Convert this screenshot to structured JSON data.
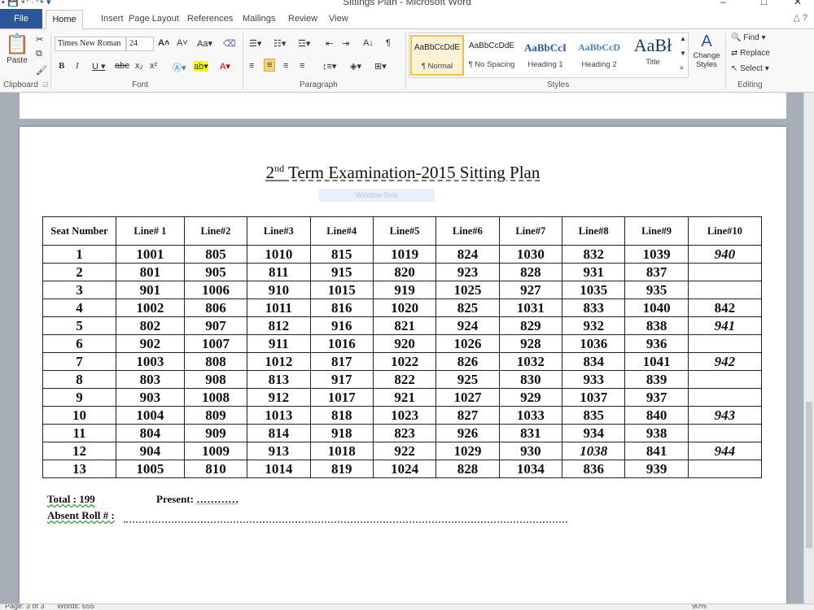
{
  "window": {
    "title": "Sittings Plan - Microsoft Word"
  },
  "ribbon": {
    "file_tab": "File",
    "tabs": [
      "Home",
      "Insert",
      "Page Layout",
      "References",
      "Mailings",
      "Review",
      "View"
    ],
    "clipboard": {
      "paste": "Paste",
      "group": "Clipboard"
    },
    "font": {
      "name": "Times New Roman",
      "size": "24",
      "group": "Font"
    },
    "paragraph": {
      "group": "Paragraph"
    },
    "styles": {
      "group": "Styles",
      "items": [
        {
          "preview": "AaBbCcDdE",
          "name": "¶ Normal"
        },
        {
          "preview": "AaBbCcDdE",
          "name": "¶ No Spacing"
        },
        {
          "preview": "AaBbCcI",
          "name": "Heading 1"
        },
        {
          "preview": "AaBbCcD",
          "name": "Heading 2"
        },
        {
          "preview": "AaBł",
          "name": "Title"
        }
      ],
      "change_styles": "Change Styles"
    },
    "editing": {
      "find": "Find",
      "replace": "Replace",
      "select": "Select",
      "group": "Editing"
    }
  },
  "document": {
    "title_sup": "nd",
    "title_num": "2",
    "title_rest": " Term Examination-2015 Sitting Plan",
    "ghost_text": "Window Snip",
    "table": {
      "headers": [
        "Seat Number",
        "Line# 1",
        "Line#2",
        "Line#3",
        "Line#4",
        "Line#5",
        "Line#6",
        "Line#7",
        "Line#8",
        "Line#9",
        "Line#10"
      ],
      "rows": [
        [
          "1",
          "1001",
          "805",
          "1010",
          "815",
          "1019",
          "824",
          "1030",
          "832",
          "1039",
          "940"
        ],
        [
          "2",
          "801",
          "905",
          "811",
          "915",
          "820",
          "923",
          "828",
          "931",
          "837",
          ""
        ],
        [
          "3",
          "901",
          "1006",
          "910",
          "1015",
          "919",
          "1025",
          "927",
          "1035",
          "935",
          ""
        ],
        [
          "4",
          "1002",
          "806",
          "1011",
          "816",
          "1020",
          "825",
          "1031",
          "833",
          "1040",
          "842"
        ],
        [
          "5",
          "802",
          "907",
          "812",
          "916",
          "821",
          "924",
          "829",
          "932",
          "838",
          "941"
        ],
        [
          "6",
          "902",
          "1007",
          "911",
          "1016",
          "920",
          "1026",
          "928",
          "1036",
          "936",
          ""
        ],
        [
          "7",
          "1003",
          "808",
          "1012",
          "817",
          "1022",
          "826",
          "1032",
          "834",
          "1041",
          "942"
        ],
        [
          "8",
          "803",
          "908",
          "813",
          "917",
          "822",
          "925",
          "830",
          "933",
          "839",
          ""
        ],
        [
          "9",
          "903",
          "1008",
          "912",
          "1017",
          "921",
          "1027",
          "929",
          "1037",
          "937",
          ""
        ],
        [
          "10",
          "1004",
          "809",
          "1013",
          "818",
          "1023",
          "827",
          "1033",
          "835",
          "840",
          "943"
        ],
        [
          "11",
          "804",
          "909",
          "814",
          "918",
          "823",
          "926",
          "831",
          "934",
          "938",
          ""
        ],
        [
          "12",
          "904",
          "1009",
          "913",
          "1018",
          "922",
          "1029",
          "930",
          "1038",
          "841",
          "944"
        ],
        [
          "13",
          "1005",
          "810",
          "1014",
          "819",
          "1024",
          "828",
          "1034",
          "836",
          "939",
          ""
        ]
      ]
    },
    "total_label": "Total : 199",
    "present_label": "Present:",
    "present_dots": "…………",
    "absent_label": "Absent Roll # :"
  },
  "status": {
    "page": "Page: 3 of 3",
    "words": "Words: 655",
    "zoom": "90%"
  }
}
